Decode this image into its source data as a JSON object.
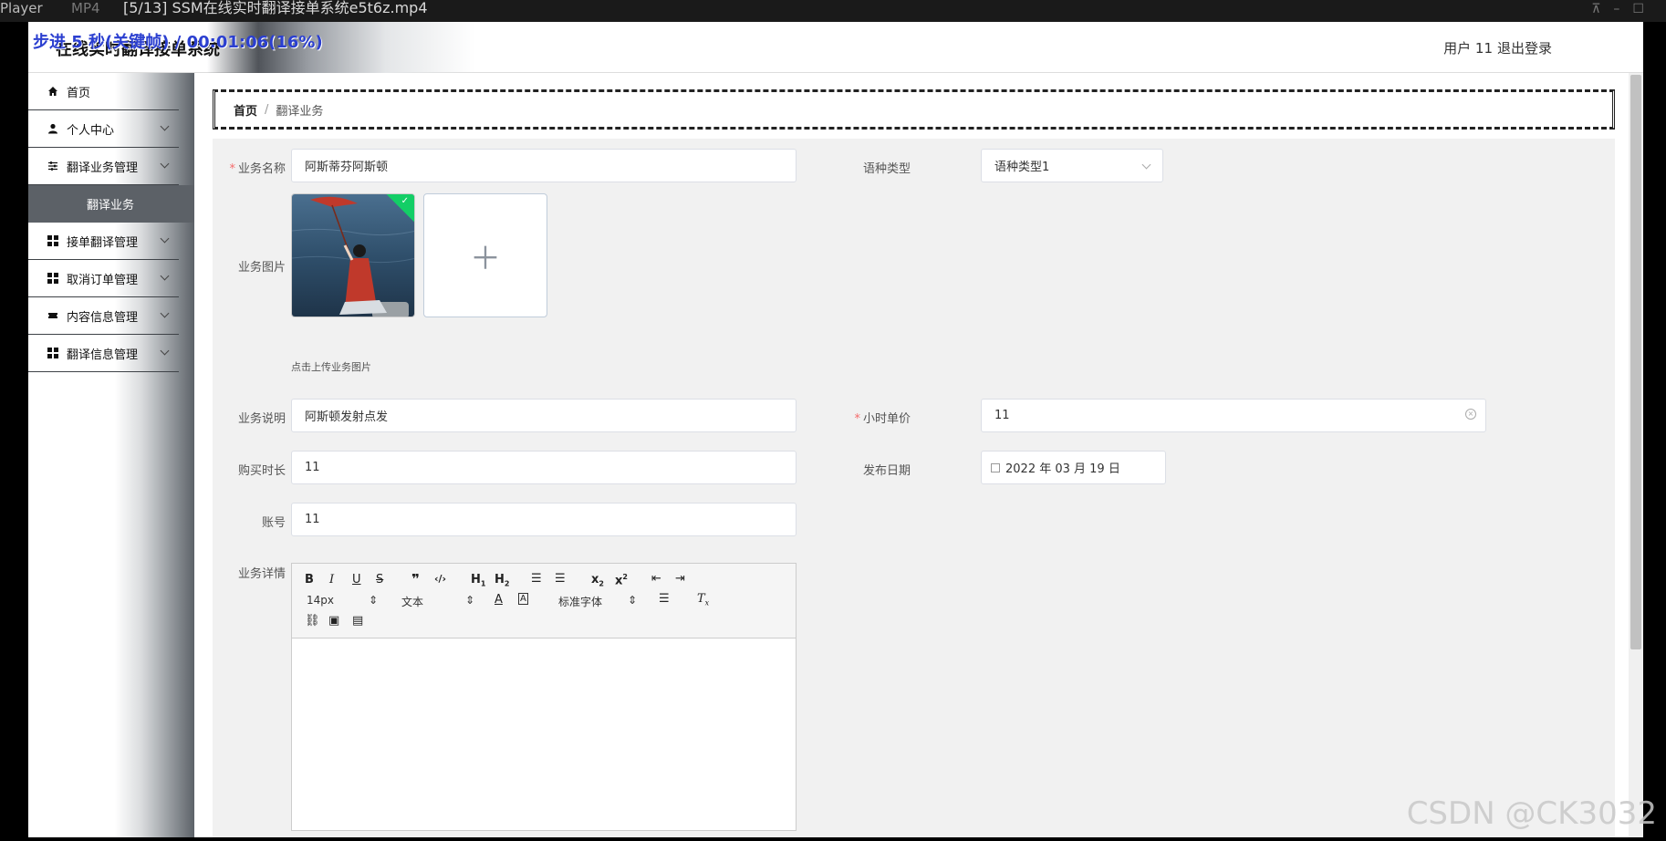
{
  "player": {
    "name": "Player",
    "format": "MP4",
    "title": "[5/13] SSM在线实时翻译接单系统e5t6z.mp4",
    "overlay": "索：步进 5 秒(关键帧) / 00:01:06(16%)"
  },
  "header": {
    "app_title": "在线实时翻译接单系统",
    "user": "用户 11",
    "logout": "退出登录"
  },
  "sidebar": {
    "items": [
      {
        "label": "首页"
      },
      {
        "label": "个人中心"
      },
      {
        "label": "翻译业务管理"
      },
      {
        "label": "翻译业务"
      },
      {
        "label": "接单翻译管理"
      },
      {
        "label": "取消订单管理"
      },
      {
        "label": "内容信息管理"
      },
      {
        "label": "翻译信息管理"
      }
    ]
  },
  "breadcrumb": {
    "home": "首页",
    "separator": "/",
    "current": "翻译业务"
  },
  "form": {
    "business_name_label": "业务名称",
    "business_name_value": "阿斯蒂芬阿斯顿",
    "language_label": "语种类型",
    "language_value": "语种类型1",
    "image_label": "业务图片",
    "upload_tip": "点击上传业务图片",
    "desc_label": "业务说明",
    "desc_value": "阿斯顿发射点发",
    "hourly_label": "小时单价",
    "hourly_value": "11",
    "duration_label": "购买时长",
    "duration_value": "11",
    "date_label": "发布日期",
    "date_value": "2022 年 03 月 19 日",
    "account_label": "账号",
    "account_value": "11",
    "detail_label": "业务详情"
  },
  "editor": {
    "font_size": "14px",
    "header_select": "文本",
    "font_family": "标准字体"
  },
  "watermark": "CSDN @CK3032"
}
